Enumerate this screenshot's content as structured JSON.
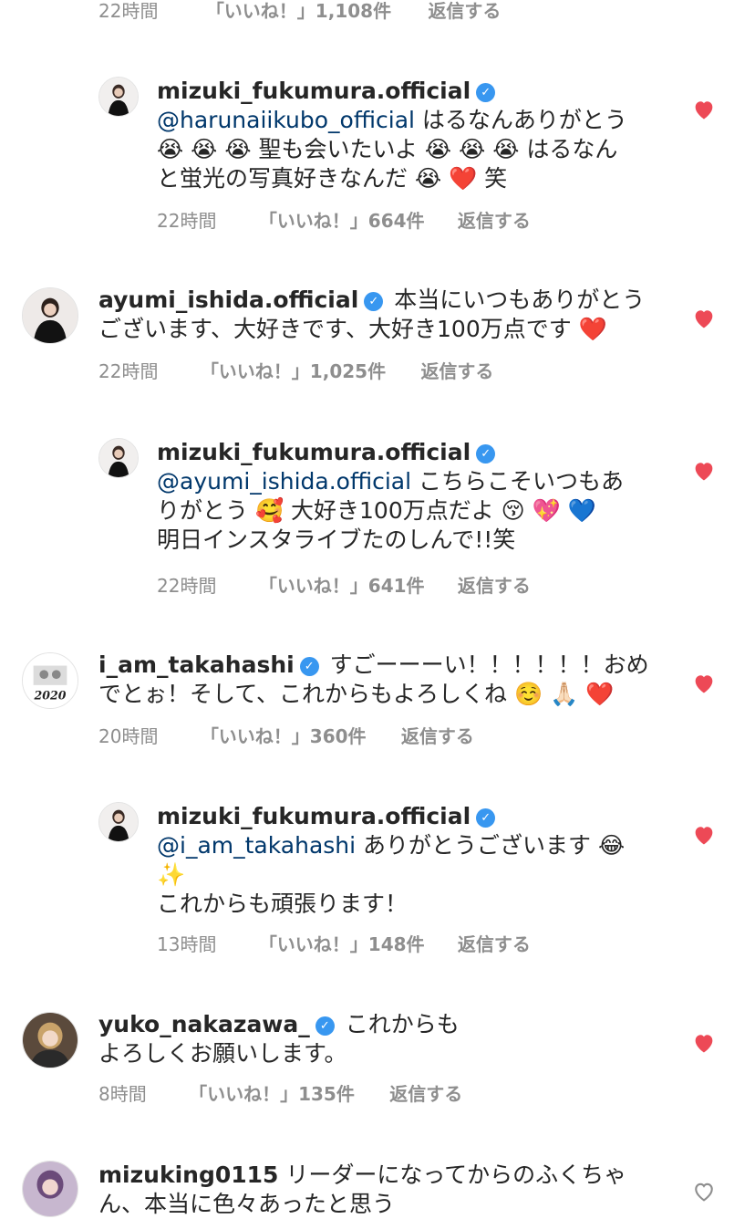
{
  "top_meta": {
    "time": "22時間",
    "likes": "「いいね！」1,108件",
    "reply": "返信する"
  },
  "comments": [
    {
      "username": "mizuki_fukumura.official",
      "mention": "@harunaiikubo_official",
      "line1_rest": " はるなんありがとう",
      "line2": "😭 😭 😭 聖も会いたいよ 😭 😭 😭 はるなん",
      "line3": "と蛍光の写真好きなんだ 😭 ❤️ 笑",
      "time": "22時間",
      "likes": "「いいね！」664件",
      "reply": "返信する"
    },
    {
      "username": "ayumi_ishida.official",
      "line1_rest": " 本当にいつもありがとう",
      "line2": "ございます、大好きです、大好き100万点です ❤️",
      "time": "22時間",
      "likes": "「いいね！」1,025件",
      "reply": "返信する"
    },
    {
      "username": "mizuki_fukumura.official",
      "mention": "@ayumi_ishida.official",
      "line1_rest": " こちらこそいつもあ",
      "line2": "りがとう 🥰 大好き100万点だよ 😚 💖 💙",
      "line3": "明日インスタライブたのしんで!!笑",
      "time": "22時間",
      "likes": "「いいね！」641件",
      "reply": "返信する"
    },
    {
      "username": "i_am_takahashi",
      "line1_rest": " すごーーーい！！！！！！おめ",
      "line2": "でとぉ！そして、これからもよろしくね ☺️ 🙏🏻 ❤️",
      "time": "20時間",
      "likes": "「いいね！」360件",
      "reply": "返信する"
    },
    {
      "username": "mizuki_fukumura.official",
      "mention": "@i_am_takahashi",
      "line1_rest": " ありがとうございます 😂",
      "line2": "✨",
      "line3": "これからも頑張ります！",
      "time": "13時間",
      "likes": "「いいね！」148件",
      "reply": "返信する"
    },
    {
      "username": "yuko_nakazawa_",
      "line1_rest": " これからも",
      "line2": "よろしくお願いします。",
      "time": "8時間",
      "likes": "「いいね！」135件",
      "reply": "返信する"
    },
    {
      "username": "mizuking0115",
      "line1_rest": " リーダーになってからのふくちゃ",
      "line2": "ん、本当に色々あったと思う"
    }
  ],
  "colors": {
    "heart_liked": "#ed4956",
    "verified": "#3897f0",
    "meta": "#8e8e8e",
    "mention": "#00376b"
  },
  "icons": {
    "liked": "heart-filled-icon",
    "unliked": "heart-outline-icon",
    "verified": "verified-badge-icon"
  }
}
